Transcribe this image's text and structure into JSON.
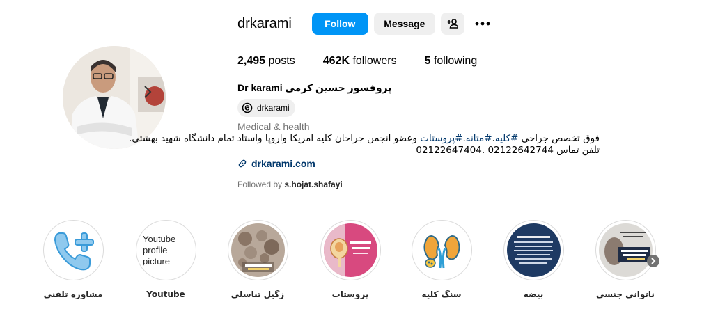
{
  "profile": {
    "username": "drkarami",
    "follow_label": "Follow",
    "message_label": "Message",
    "stats": {
      "posts_count": "2,495",
      "posts_label": "posts",
      "followers_count": "462K",
      "followers_label": "followers",
      "following_count": "5",
      "following_label": "following"
    },
    "full_name": "Dr karami پروفسور حسین کرمی",
    "threads_handle": "drkarami",
    "category": "Medical & health",
    "bio": {
      "line1_prefix": "فوق تخصص جراحی ",
      "tags": [
        "#کلیه",
        "#مثانه",
        "#پروستات"
      ],
      "line1_suffix": " وعضو انجمن جراحان کلیه امریکا واروپا واستاد تمام دانشگاه شهید بهشتی.",
      "line2": "تلفن تماس 02122642744 .02122647404"
    },
    "website": "drkarami.com",
    "followed_by_prefix": "Followed by",
    "followed_by_user": "s.hojat.shafayi"
  },
  "highlights": [
    {
      "label": "مشاوره تلفنی",
      "icon": "phone-plus-icon"
    },
    {
      "label": "Youtube",
      "icon": "broken-image",
      "alt": "Youtube profile picture"
    },
    {
      "label": "زگیل تناسلی",
      "icon": "photo"
    },
    {
      "label": "پروستات",
      "icon": "photo"
    },
    {
      "label": "سنگ کلیه",
      "icon": "kidney-icon"
    },
    {
      "label": "بیضه",
      "icon": "photo"
    },
    {
      "label": "ناتوانی جنسی",
      "icon": "photo"
    }
  ],
  "colors": {
    "follow_button": "#0095f6",
    "secondary_button": "#efefef",
    "link": "#00376b",
    "muted": "#737373"
  }
}
